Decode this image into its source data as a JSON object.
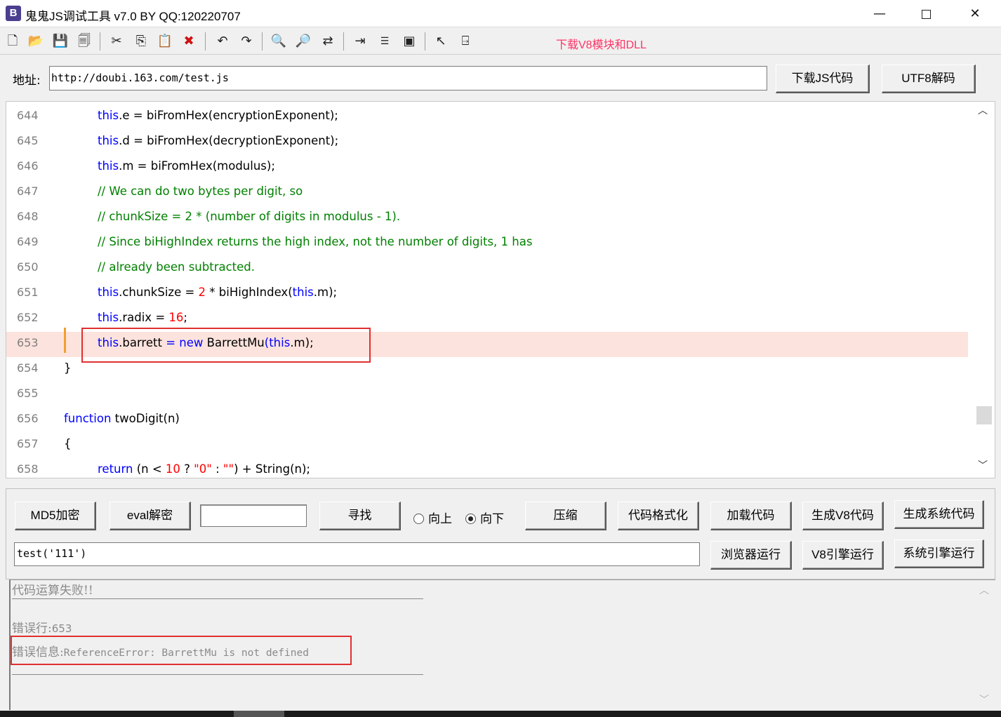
{
  "window": {
    "title": "鬼鬼JS调试工具 v7.0 BY QQ:120220707",
    "icon_letter": "B",
    "min": "—",
    "close": "✕"
  },
  "toolbar": {
    "icons": [
      "new-file-icon",
      "open-folder-icon",
      "save-icon",
      "save-all-icon",
      "cut-icon",
      "copy-icon",
      "paste-icon",
      "delete-icon",
      "undo-icon",
      "redo-icon",
      "find-icon",
      "find-next-icon",
      "replace-icon",
      "indent-icon",
      "numbered-list-icon",
      "window-icon",
      "help-pointer-icon",
      "exit-icon"
    ],
    "download_link": "下载V8模块和DLL"
  },
  "address": {
    "label": "地址:",
    "value": "http://doubi.163.com/test.js",
    "download_button": "下载JS代码",
    "utf8_button": "UTF8解码"
  },
  "editor": {
    "lines": [
      {
        "n": "644",
        "indent": 2,
        "tokens": [
          [
            "kw",
            "this"
          ],
          [
            "",
            "."
          ],
          [
            "",
            "e = biFromHex(encryptionExponent);"
          ]
        ]
      },
      {
        "n": "645",
        "indent": 2,
        "tokens": [
          [
            "kw",
            "this"
          ],
          [
            "",
            ".d = biFromHex(decryptionExponent);"
          ]
        ]
      },
      {
        "n": "646",
        "indent": 2,
        "tokens": [
          [
            "kw",
            "this"
          ],
          [
            "",
            ".m = biFromHex(modulus);"
          ]
        ]
      },
      {
        "n": "647",
        "indent": 2,
        "tokens": [
          [
            "cm",
            "// We can do two bytes per digit, so"
          ]
        ]
      },
      {
        "n": "648",
        "indent": 2,
        "tokens": [
          [
            "cm",
            "// chunkSize = 2 * (number of digits in modulus - 1)."
          ]
        ]
      },
      {
        "n": "649",
        "indent": 2,
        "tokens": [
          [
            "cm",
            "// Since biHighIndex returns the high index, not the number of digits, 1 has"
          ]
        ]
      },
      {
        "n": "650",
        "indent": 2,
        "tokens": [
          [
            "cm",
            "// already been subtracted."
          ]
        ]
      },
      {
        "n": "651",
        "indent": 2,
        "tokens": [
          [
            "kw",
            "this"
          ],
          [
            "",
            ".chunkSize = "
          ],
          [
            "num",
            "2"
          ],
          [
            "",
            " * biHighIndex("
          ],
          [
            "kw",
            "this"
          ],
          [
            "",
            ".m);"
          ]
        ]
      },
      {
        "n": "652",
        "indent": 2,
        "tokens": [
          [
            "kw",
            "this"
          ],
          [
            "",
            ".radix = "
          ],
          [
            "num",
            "16"
          ],
          [
            "",
            ";"
          ]
        ]
      },
      {
        "n": "653",
        "indent": 2,
        "highlight": true,
        "tokens": [
          [
            "kw",
            "this"
          ],
          [
            "",
            ".barrett "
          ],
          [
            "kw",
            "="
          ],
          [
            "",
            " "
          ],
          [
            "kw",
            "new"
          ],
          [
            "",
            " BarrettMu"
          ],
          [
            "kw",
            "("
          ],
          [
            "kw",
            "this"
          ],
          [
            "",
            ".m);"
          ]
        ]
      },
      {
        "n": "654",
        "indent": 1,
        "tokens": [
          [
            "",
            "}"
          ]
        ]
      },
      {
        "n": "655",
        "indent": 1,
        "tokens": []
      },
      {
        "n": "656",
        "indent": 1,
        "tokens": [
          [
            "kw",
            "function"
          ],
          [
            "",
            " twoDigit(n)"
          ]
        ]
      },
      {
        "n": "657",
        "indent": 1,
        "tokens": [
          [
            "",
            "{"
          ]
        ]
      },
      {
        "n": "658",
        "indent": 2,
        "tokens": [
          [
            "kw",
            "return"
          ],
          [
            "",
            " (n < "
          ],
          [
            "num",
            "10"
          ],
          [
            "",
            " ? "
          ],
          [
            "num",
            "\"0\""
          ],
          [
            "",
            " : "
          ],
          [
            "num",
            "\"\""
          ],
          [
            "",
            ") + String(n);"
          ]
        ]
      }
    ],
    "scroll_up": "︿",
    "scroll_down": "﹀"
  },
  "panel": {
    "md5_button": "MD5加密",
    "eval_button": "eval解密",
    "search_value": "",
    "find_button": "寻找",
    "radio_up": "向上",
    "radio_down": "向下",
    "compress_button": "压缩",
    "format_button": "代码格式化",
    "load_button": "加载代码",
    "gen_v8_button": "生成V8代码",
    "gen_sys_button": "生成系统代码",
    "call_value": "test('111')",
    "browser_run_button": "浏览器运行",
    "v8_run_button": "V8引擎运行",
    "sys_run_button": "系统引擎运行"
  },
  "output": {
    "fail_text": "代码运算失败!!",
    "error_line_label": "错误行:",
    "error_line_value": "653",
    "error_info_label": "错误信息:",
    "error_info_value": "ReferenceError: BarrettMu is not defined",
    "scroll_up": "︿",
    "scroll_down": "﹀"
  },
  "colors": {
    "keyword": "#0000ff",
    "comment": "#008000",
    "number": "#ff0000",
    "highlight_line": "#fde3dd",
    "annotation_box": "#e03030",
    "download_link": "#ff3366"
  }
}
